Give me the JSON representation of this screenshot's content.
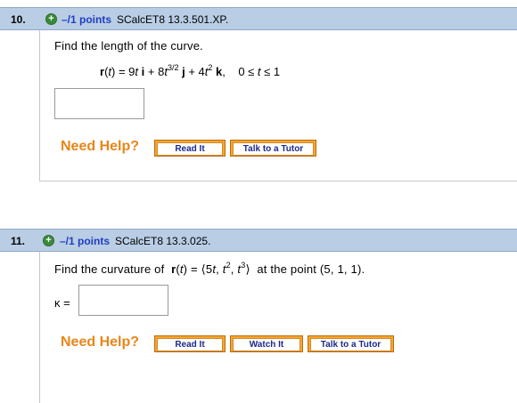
{
  "q10": {
    "number": "10.",
    "points": "–/1 points",
    "code": "SCalcET8 13.3.501.XP.",
    "prompt": "Find the length of the curve.",
    "need_help": "Need Help?",
    "buttons": [
      "Read It",
      "Talk to a Tutor"
    ]
  },
  "q11": {
    "number": "11.",
    "points": "–/1 points",
    "code": "SCalcET8 13.3.025.",
    "prompt_pre": "Find the curvature of",
    "prompt_post": "at the point  (5, 1, 1).",
    "answer_label": "κ =",
    "need_help": "Need Help?",
    "buttons": [
      "Read It",
      "Watch It",
      "Talk to a Tutor"
    ]
  },
  "colors": {
    "header_bg": "#b9cde5",
    "points_text": "#1f3fbf",
    "need_help": "#e8861a",
    "button_orange": "#f8a52b",
    "button_text": "#1b2a8c",
    "plus_green": "#3a8a3a"
  },
  "icons": [
    "plus-icon"
  ]
}
